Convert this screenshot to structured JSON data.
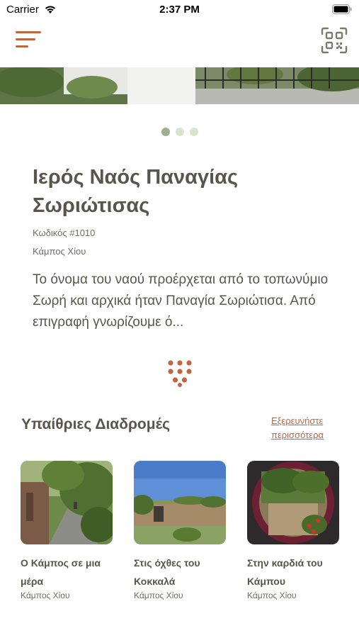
{
  "status_bar": {
    "carrier": "Carrier",
    "time": "2:37 PM"
  },
  "header": {
    "menu_icon": "hamburger-menu-icon",
    "qr_icon": "qr-code-scan-icon",
    "accent_color": "#c0663f"
  },
  "carousel": {
    "dot_count": 3,
    "active_index": 0
  },
  "site": {
    "title": "Ιερός Ναός Παναγίας Σωριώτισας",
    "code": "Κωδικός #1010",
    "location": "Κάμπος Χίου",
    "description": "Το όνομα του ναού προέρχεται από το τοπωνύμιο Σωρή και αρχικά ήταν Παναγία Σωριώτισα. Από επιγραφή γνωρίζουμε ό..."
  },
  "more_icon": "dot-grid-icon",
  "routes_section": {
    "title": "Υπαίθριες Διαδρομές",
    "explore_label": "Εξερευνήστε περισσότερα",
    "routes": [
      {
        "title": "Ο Κάμπος σε μια μέρα",
        "location": "Κάμπος Χίου"
      },
      {
        "title": "Στις όχθες του Κοκκαλά",
        "location": "Κάμπος Χίου"
      },
      {
        "title": "Στην καρδιά του Κάμπου",
        "location": "Κάμπος Χίου"
      }
    ]
  }
}
